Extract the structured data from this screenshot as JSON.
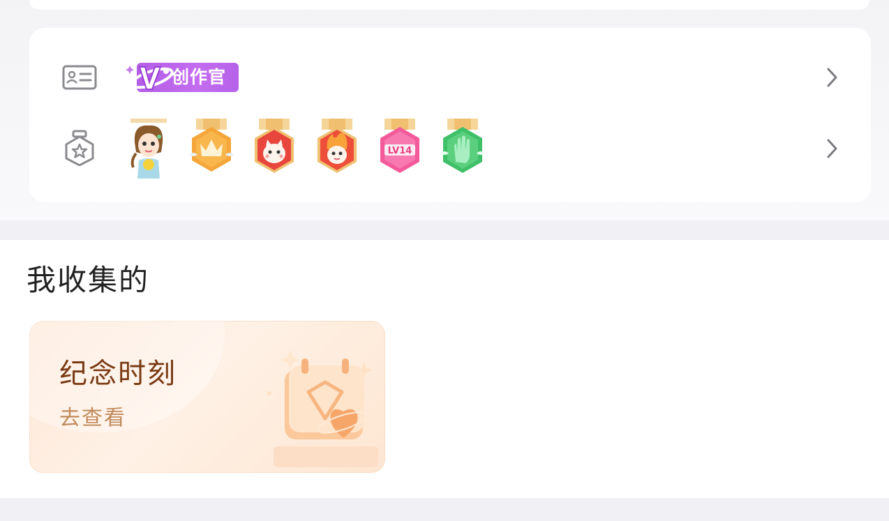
{
  "profile": {
    "identity_row": {
      "icon": "id-card-icon",
      "creator_tag": "创作官",
      "chevron": "chevron-right-icon"
    },
    "badges_row": {
      "icon": "medal-star-icon",
      "chevron": "chevron-right-icon",
      "badges": [
        {
          "name": "girl-avatar-badge"
        },
        {
          "name": "crown-badge"
        },
        {
          "name": "red-cat-badge"
        },
        {
          "name": "fire-dragon-badge"
        },
        {
          "name": "level-badge",
          "text": "LV14"
        },
        {
          "name": "green-hand-badge"
        }
      ]
    }
  },
  "collections": {
    "title": "我收集的",
    "memory_card": {
      "title": "纪念时刻",
      "action": "去查看",
      "illustration": "calendar-heart-icon"
    }
  },
  "colors": {
    "creator_purple": "#b35ee6",
    "card_peach": "#fde7d6",
    "card_title": "#7a3b14",
    "card_sub": "#c08a5a"
  }
}
